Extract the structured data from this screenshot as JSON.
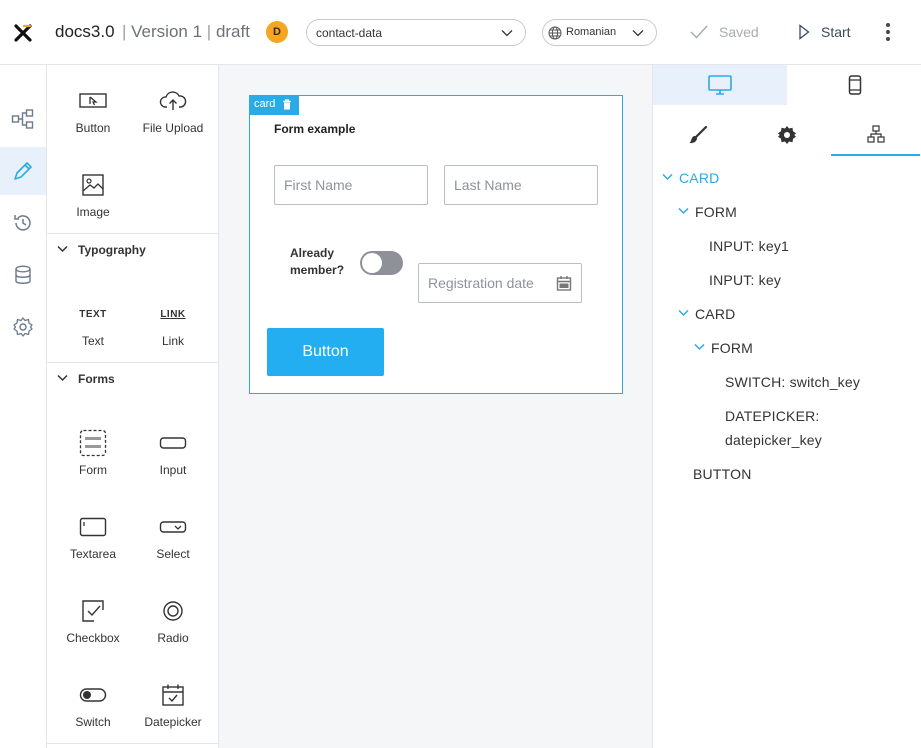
{
  "header": {
    "app_name": "docs3.0",
    "sep1": "|",
    "version": "Version 1",
    "sep2": "|",
    "state": "draft",
    "badge": "D",
    "data_source": "contact-data",
    "language": "Romanian",
    "saved_label": "Saved",
    "start_label": "Start"
  },
  "palette": {
    "basic": [
      {
        "label": "Button",
        "icon": "button-icon"
      },
      {
        "label": "File Upload",
        "icon": "upload-cloud-icon"
      },
      {
        "label": "Image",
        "icon": "image-icon"
      }
    ],
    "typography": {
      "title": "Typography",
      "items": [
        {
          "label": "Text",
          "glyph": "TEXT",
          "icon": "text-icon"
        },
        {
          "label": "Link",
          "glyph": "LINK",
          "icon": "link-icon"
        }
      ]
    },
    "forms": {
      "title": "Forms",
      "items": [
        {
          "label": "Form",
          "icon": "form-icon"
        },
        {
          "label": "Input",
          "icon": "input-icon"
        },
        {
          "label": "Textarea",
          "icon": "textarea-icon"
        },
        {
          "label": "Select",
          "icon": "select-icon"
        },
        {
          "label": "Checkbox",
          "icon": "checkbox-icon"
        },
        {
          "label": "Radio",
          "icon": "radio-icon"
        },
        {
          "label": "Switch",
          "icon": "switch-icon"
        },
        {
          "label": "Datepicker",
          "icon": "datepicker-icon"
        }
      ]
    }
  },
  "canvas": {
    "card_tag": "card",
    "form_title": "Form example",
    "first_name_placeholder": "First Name",
    "last_name_placeholder": "Last Name",
    "member_label": "Already member?",
    "switch_on": false,
    "date_placeholder": "Registration date",
    "button_label": "Button"
  },
  "tree": [
    {
      "label": "CARD",
      "selected": true,
      "expanded": true
    },
    {
      "label": "FORM",
      "expanded": true
    },
    {
      "label": "INPUT: key1"
    },
    {
      "label": "INPUT: key"
    },
    {
      "label": "CARD",
      "expanded": true
    },
    {
      "label": "FORM",
      "expanded": true
    },
    {
      "label": "SWITCH: switch_key"
    },
    {
      "label": "DATEPICKER:"
    },
    {
      "label": "datepicker_key"
    },
    {
      "label": "BUTTON"
    }
  ],
  "colors": {
    "accent": "#2aabe6",
    "button": "#22aef0",
    "badge": "#f5a623"
  }
}
